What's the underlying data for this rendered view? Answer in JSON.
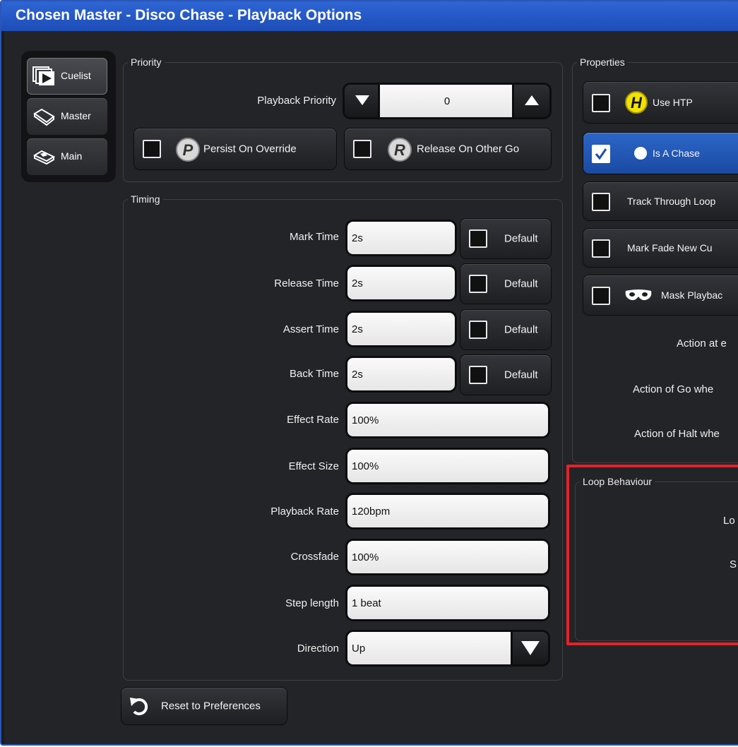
{
  "window": {
    "title": "Chosen Master - Disco Chase - Playback Options"
  },
  "tabs": [
    {
      "label": "Cuelist",
      "icon": "cuelist-icon",
      "active": true
    },
    {
      "label": "Master",
      "icon": "master-icon",
      "active": false
    },
    {
      "label": "Main",
      "icon": "main-icon",
      "active": false
    }
  ],
  "priority": {
    "group_label": "Priority",
    "playback_priority_label": "Playback Priority",
    "playback_priority_value": "0",
    "persist_on_override": {
      "label": "Persist On Override",
      "checked": false
    },
    "release_on_other_go": {
      "label": "Release On Other Go",
      "checked": false
    }
  },
  "timing": {
    "group_label": "Timing",
    "rows": [
      {
        "label": "Mark Time",
        "value": "2s",
        "default_label": "Default",
        "has_default": true
      },
      {
        "label": "Release Time",
        "value": "2s",
        "default_label": "Default",
        "has_default": true
      },
      {
        "label": "Assert Time",
        "value": "2s",
        "default_label": "Default",
        "has_default": true
      },
      {
        "label": "Back Time",
        "value": "2s",
        "default_label": "Default",
        "has_default": true
      },
      {
        "label": "Effect Rate",
        "value": "100%"
      },
      {
        "label": "Effect Size",
        "value": "100%"
      },
      {
        "label": "Playback Rate",
        "value": "120bpm"
      },
      {
        "label": "Crossfade",
        "value": "100%"
      },
      {
        "label": "Step length",
        "value": "1 beat"
      }
    ],
    "direction_label": "Direction",
    "direction_value": "Up"
  },
  "properties": {
    "group_label": "Properties",
    "items": [
      {
        "label": "Use HTP",
        "checked": false,
        "icon": "htp-icon"
      },
      {
        "label": "Is A Chase",
        "checked": true,
        "icon": "chase-icon"
      },
      {
        "label": "Track Through Loop",
        "checked": false
      },
      {
        "label": "Mark Fade New Cu",
        "checked": false
      },
      {
        "label": "Mask Playbac",
        "checked": false,
        "icon": "mask-icon"
      }
    ],
    "action_labels": [
      "Action at e",
      "Action of Go whe",
      "Action of Halt whe"
    ]
  },
  "loop_behaviour": {
    "group_label": "Loop Behaviour",
    "labels": [
      "Lo",
      "S"
    ],
    "highlight_color": "#e3222a"
  },
  "reset_button": {
    "label": "Reset to Preferences",
    "icon": "undo-icon"
  }
}
